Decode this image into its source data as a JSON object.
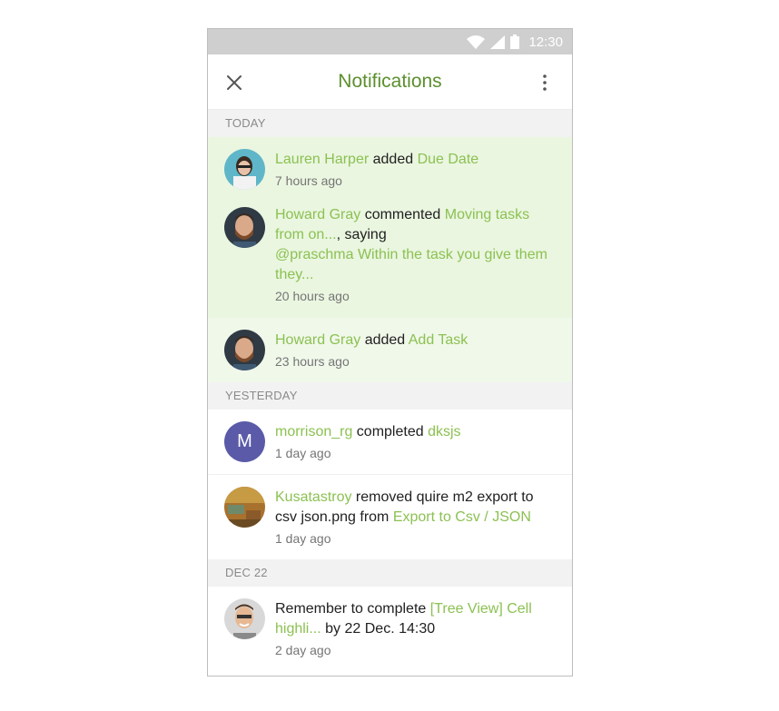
{
  "status": {
    "time": "12:30"
  },
  "header": {
    "title": "Notifications"
  },
  "sections": {
    "today": "TODAY",
    "yesterday": "YESTERDAY",
    "dec22": "DEC 22"
  },
  "items": [
    {
      "user": "Lauren Harper",
      "verb": " added ",
      "target": "Due Date",
      "time": "7 hours ago"
    },
    {
      "user": "Howard Gray",
      "verb": " commented ",
      "target": "Moving tasks from on...",
      "saying": ", saying",
      "comment": "@praschma Within the task you give them they...",
      "time": "20 hours ago"
    },
    {
      "user": "Howard Gray",
      "verb": " added ",
      "target": "Add Task",
      "time": "23 hours ago"
    },
    {
      "user": "morrison_rg",
      "verb": " completed ",
      "target": "dksjs",
      "time": "1 day ago",
      "avatar_letter": "M"
    },
    {
      "user": "Kusatastroy",
      "verb": " removed quire m2 export to csv json.png from ",
      "target": "Export to Csv / JSON",
      "time": "1 day ago"
    },
    {
      "prefix": "Remember to complete ",
      "target": "[Tree View] Cell highli...",
      "suffix": " by 22 Dec. 14:30",
      "time": "2 day ago"
    }
  ],
  "colors": {
    "accent": "#5c8f2e",
    "link": "#8cc152",
    "unread_bg": "#eaf6e0",
    "status_bar": "#cfcfcf"
  }
}
